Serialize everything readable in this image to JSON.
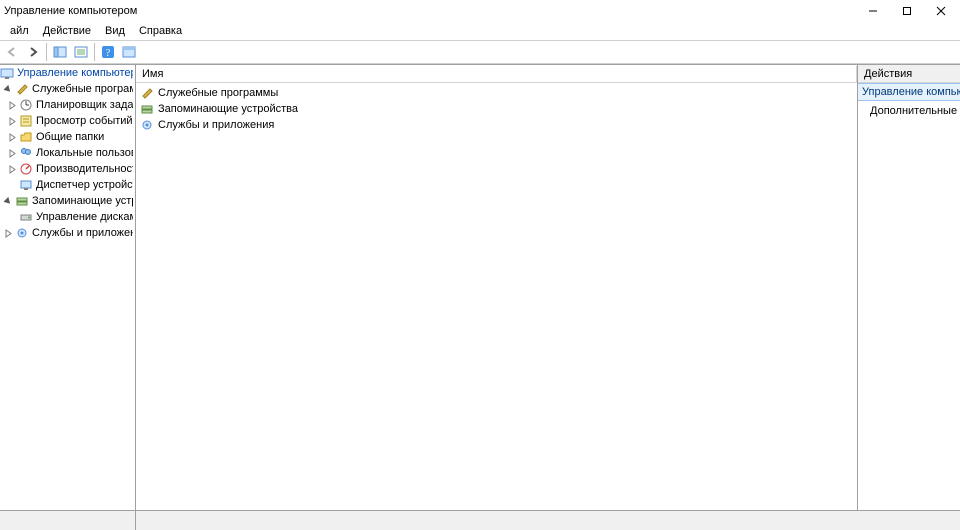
{
  "window": {
    "title": "Управление компьютером"
  },
  "menu": {
    "file": "айл",
    "action": "Действие",
    "view": "Вид",
    "help": "Справка"
  },
  "tree": {
    "root": "Управление компьютером (лс",
    "system_tools": "Служебные программы",
    "task_scheduler": "Планировщик заданий",
    "event_viewer": "Просмотр событий",
    "shared_folders": "Общие папки",
    "local_users": "Локальные пользовате",
    "performance": "Производительность",
    "device_manager": "Диспетчер устройств",
    "storage": "Запоминающие устройст",
    "disk_mgmt": "Управление дисками",
    "services_apps": "Службы и приложения"
  },
  "list": {
    "header_name": "Имя",
    "items": {
      "system_tools": "Служебные программы",
      "storage": "Запоминающие устройства",
      "services_apps": "Службы и приложения"
    }
  },
  "actions": {
    "header": "Действия",
    "group": "Управление компьютером ..",
    "more": "Дополнительные дейс..."
  }
}
